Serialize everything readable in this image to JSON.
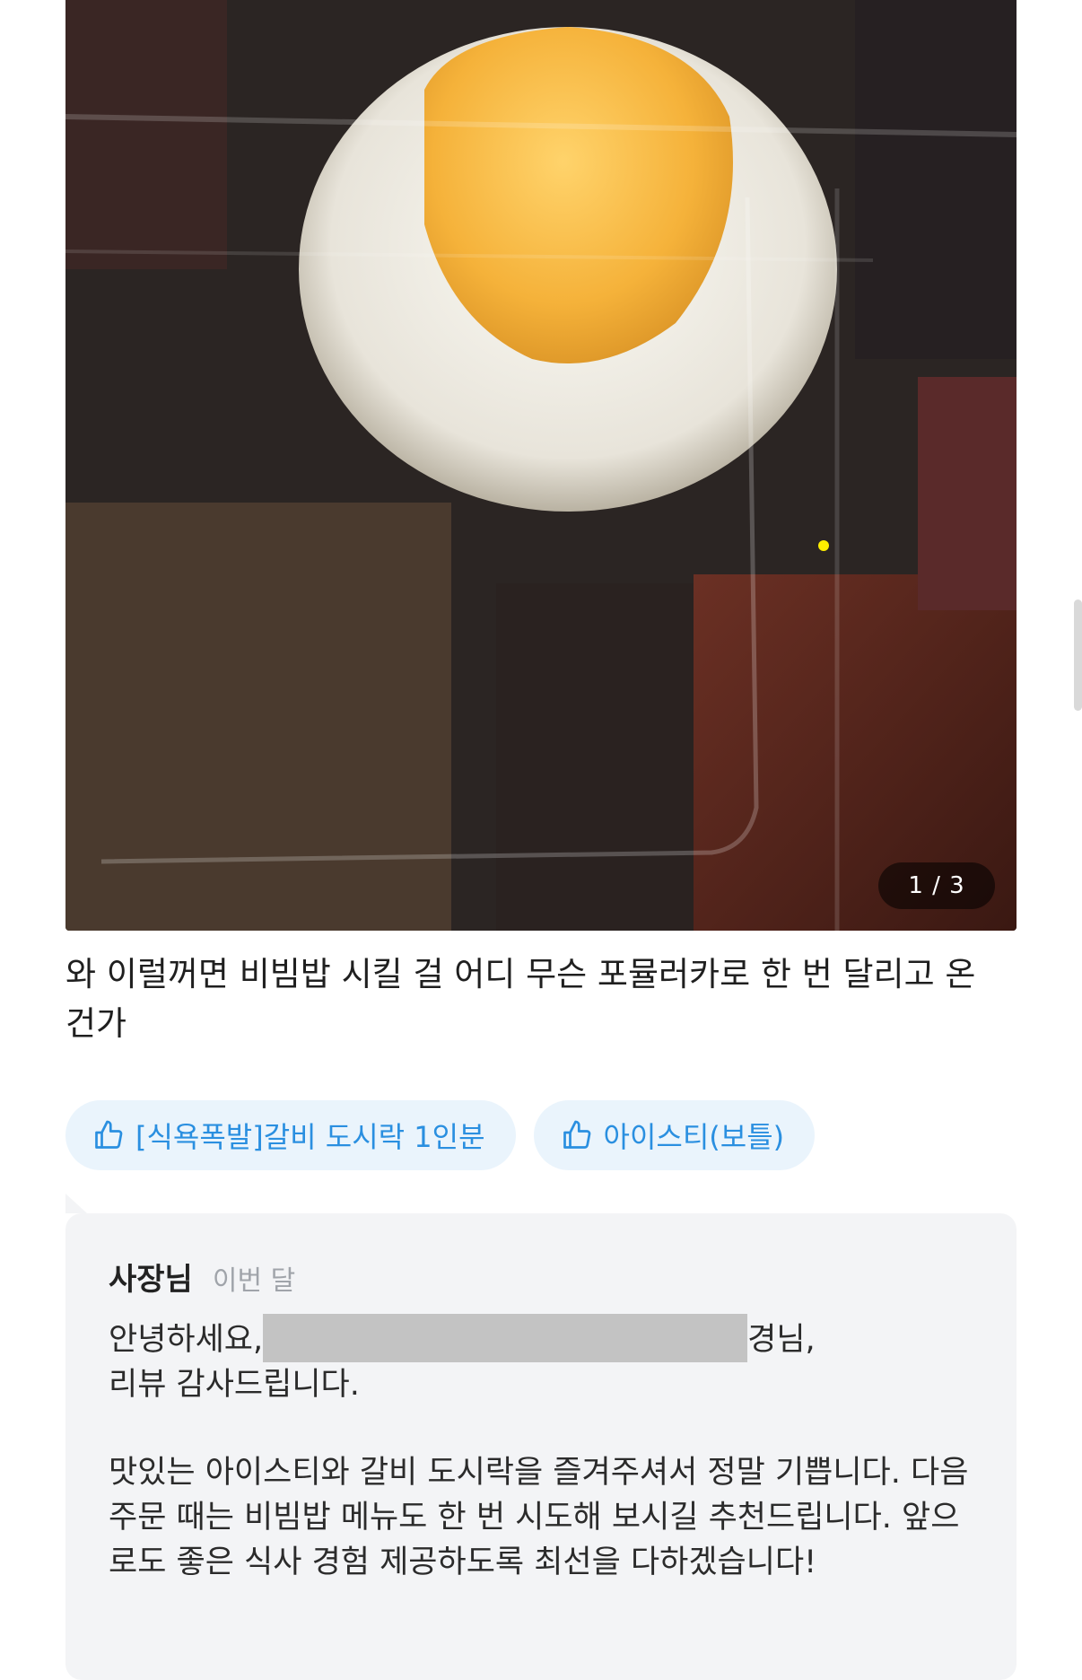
{
  "review": {
    "photo_alt": "",
    "photo_counter": "1 / 3",
    "text": "와 이럴꺼면 비빔밥 시킬 걸 어디 무슨 포뮬러카로 한 번 달리고 온 건가"
  },
  "menu_tags": [
    {
      "icon": "thumbs-up-icon",
      "label": "[식욕폭발]갈비 도시락 1인분"
    },
    {
      "icon": "thumbs-up-icon",
      "label": "아이스티(보틀)"
    }
  ],
  "reply": {
    "author": "사장님",
    "date": "이번 달",
    "greeting_prefix": "안녕하세요,",
    "greeting_suffix": "경님,",
    "line2": "리뷰 감사드립니다.",
    "body": "맛있는 아이스티와 갈비 도시락을 즐겨주셔서 정말 기쁩니다. 다음 주문 때는 비빔밥 메뉴도 한 번 시도해 보시길 추천드립니다. 앞으로도 좋은 식사 경험 제공하도록 최선을 다하겠습니다!"
  },
  "colors": {
    "tag_bg": "#eaf4fc",
    "tag_text": "#2a8fe0",
    "reply_bg": "#f3f4f6"
  }
}
